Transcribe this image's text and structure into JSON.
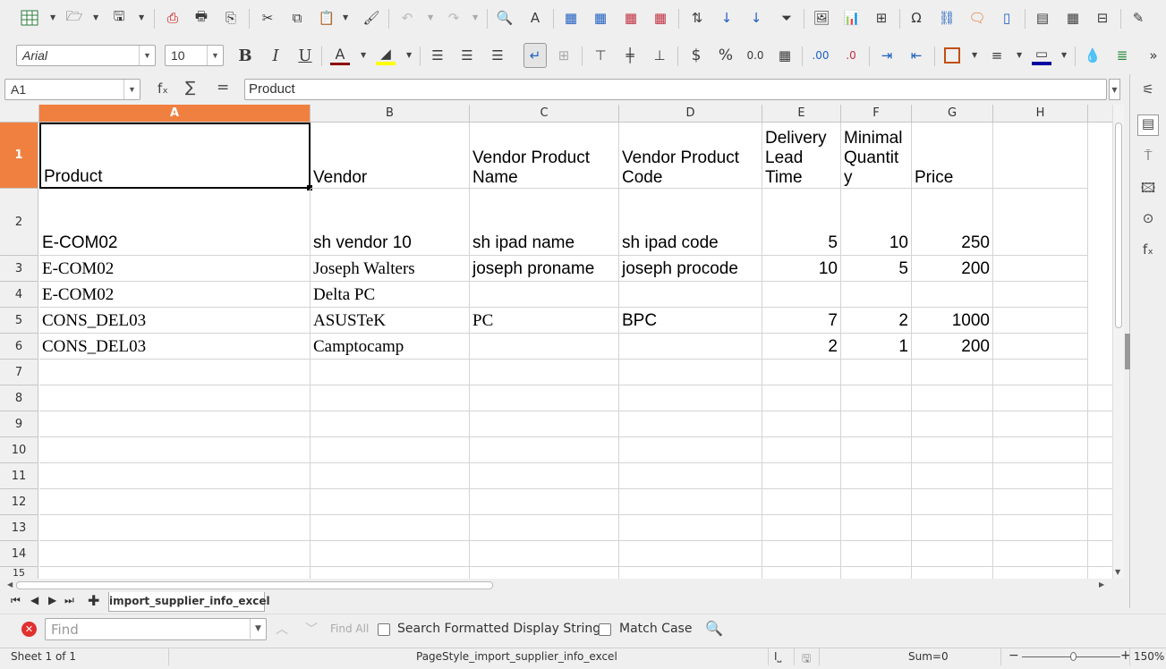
{
  "toolbar": {
    "font_name": "Arial",
    "font_size": "10",
    "colors": {
      "font_color": "#8b0000",
      "highlight": "#ffff00",
      "border_color": "#0000a0",
      "accent": "#f08040"
    }
  },
  "formula_bar": {
    "name_box": "A1",
    "function_glyph": "fₓ",
    "sum_glyph": "∑",
    "equals_glyph": "=",
    "content": "Product"
  },
  "columns": [
    "A",
    "B",
    "C",
    "D",
    "E",
    "F",
    "G",
    "H"
  ],
  "rows": [
    "1",
    "2",
    "3",
    "4",
    "5",
    "6",
    "7",
    "8",
    "9",
    "10",
    "11",
    "12",
    "13",
    "14",
    "15"
  ],
  "header_row": {
    "product": "Product",
    "vendor": "Vendor",
    "vendor_product_name": "Vendor Product Name",
    "vendor_product_code": "Vendor Product Code",
    "delivery_lead_time": "Delivery Lead Time",
    "minimal_quantity": "Minimal Quantit y",
    "price": "Price"
  },
  "data_rows": [
    {
      "product": "E-COM02",
      "vendor": "sh vendor 10",
      "name": "sh ipad name",
      "code": "sh ipad code",
      "lead": "5",
      "qty": "10",
      "price": "250"
    },
    {
      "product": "E-COM02",
      "vendor": "Joseph Walters",
      "name": "joseph proname",
      "code": "joseph procode",
      "lead": "10",
      "qty": "5",
      "price": "200"
    },
    {
      "product": "E-COM02",
      "vendor": "Delta PC",
      "name": "",
      "code": "",
      "lead": "",
      "qty": "",
      "price": ""
    },
    {
      "product": "CONS_DEL03",
      "vendor": "ASUSTeK",
      "name": "PC",
      "code": "BPC",
      "lead": "7",
      "qty": "2",
      "price": "1000"
    },
    {
      "product": "CONS_DEL03",
      "vendor": "Camptocamp",
      "name": "",
      "code": "",
      "lead": "2",
      "qty": "1",
      "price": "200"
    }
  ],
  "sheet_tab": "import_supplier_info_excel",
  "find_bar": {
    "placeholder": "Find",
    "find_all": "Find All",
    "search_formatted": "Search Formatted Display String",
    "match_case": "Match Case"
  },
  "status_bar": {
    "sheet": "Sheet 1 of 1",
    "page_style": "PageStyle_import_supplier_info_excel",
    "sum": "Sum=0",
    "zoom": "150%"
  }
}
